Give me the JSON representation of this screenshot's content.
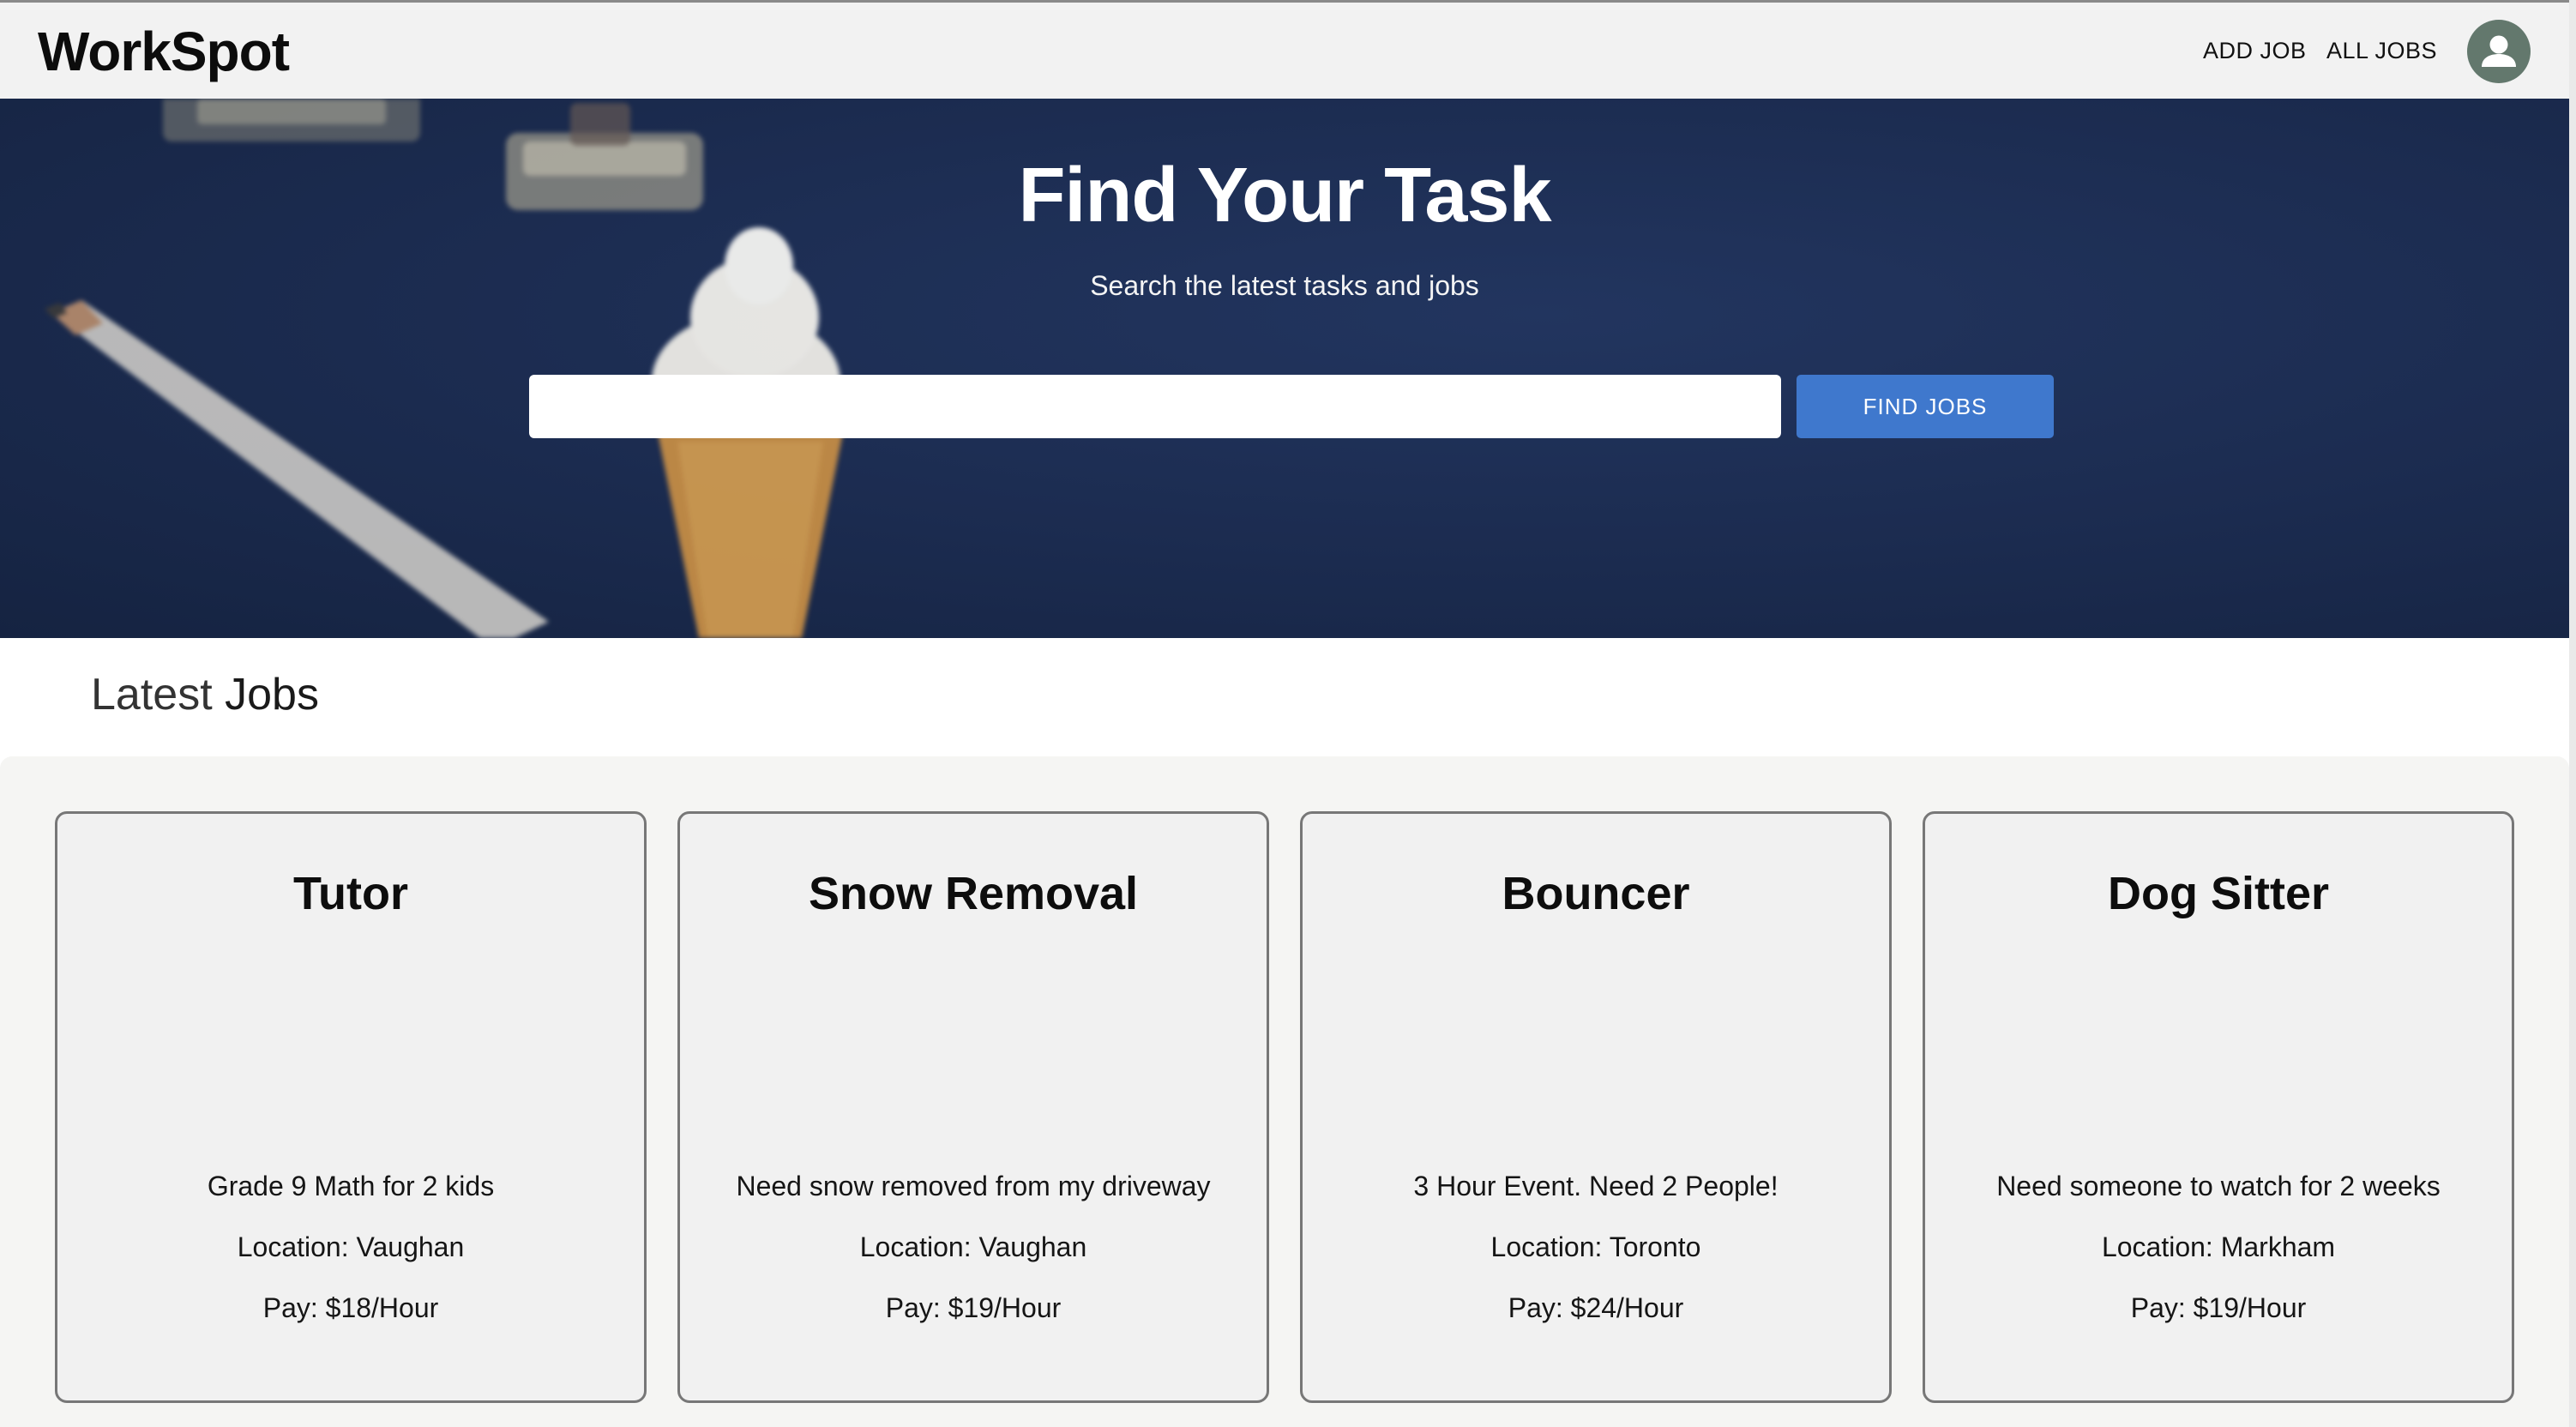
{
  "navbar": {
    "brand": "WorkSpot",
    "links": {
      "add_job": "ADD JOB",
      "all_jobs": "ALL JOBS"
    },
    "avatar_icon": "user-avatar-icon"
  },
  "hero": {
    "title": "Find Your Task",
    "subtitle": "Search the latest tasks and jobs",
    "search": {
      "value": "",
      "placeholder": ""
    },
    "button_label": "FIND JOBS"
  },
  "latest": {
    "title_light": "Latest",
    "title_bold": "Jobs",
    "jobs": [
      {
        "title": "Tutor",
        "description": "Grade 9 Math for 2 kids",
        "location": "Location: Vaughan",
        "pay": "Pay: $18/Hour"
      },
      {
        "title": "Snow Removal",
        "description": "Need snow removed from my driveway",
        "location": "Location: Vaughan",
        "pay": "Pay: $19/Hour"
      },
      {
        "title": "Bouncer",
        "description": "3 Hour Event. Need 2 People!",
        "location": "Location: Toronto",
        "pay": "Pay: $24/Hour"
      },
      {
        "title": "Dog Sitter",
        "description": "Need someone to watch for 2 weeks",
        "location": "Location: Markham",
        "pay": "Pay: $19/Hour"
      }
    ]
  },
  "colors": {
    "hero_bg": "#1b2b4f",
    "button": "#3f78cd",
    "avatar": "#63786d",
    "navbar_bg": "#f2f2f2"
  }
}
